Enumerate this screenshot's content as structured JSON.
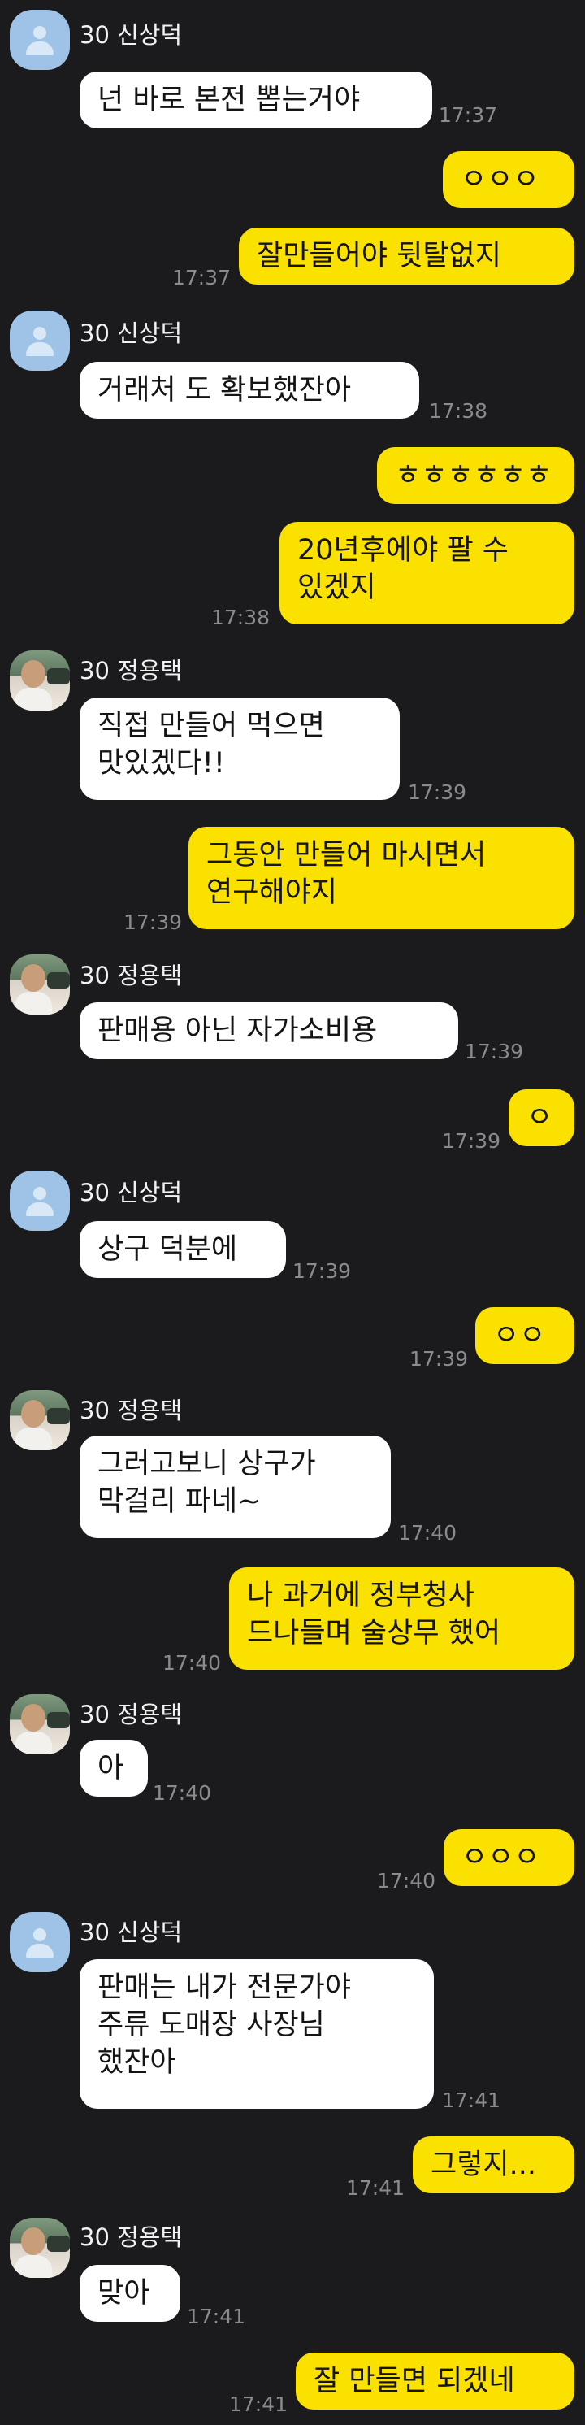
{
  "messages": [
    {
      "sender": "30 신상덕",
      "text": "넌 바로 본전 뽑는거야",
      "time": "17:37"
    },
    {
      "text": "ㅇㅇㅇ"
    },
    {
      "text": "잘만들어야 뒷탈없지",
      "time": "17:37"
    },
    {
      "sender": "30 신상덕",
      "text": "거래처 도 확보했잔아",
      "time": "17:38"
    },
    {
      "text": "ㅎㅎㅎㅎㅎㅎ"
    },
    {
      "text": "20년후에야 팔 수\n있겠지",
      "time": "17:38"
    },
    {
      "sender": "30 정용택",
      "text": "직접 만들어 먹으면\n맛있겠다!!",
      "time": "17:39"
    },
    {
      "text": "그동안 만들어 마시면서\n연구해야지",
      "time": "17:39"
    },
    {
      "sender": "30 정용택",
      "text": "판매용 아닌 자가소비용",
      "time": "17:39"
    },
    {
      "text": "ㅇ",
      "time": "17:39"
    },
    {
      "sender": "30 신상덕",
      "text": "상구 덕분에",
      "time": "17:39"
    },
    {
      "text": "ㅇㅇ",
      "time": "17:39"
    },
    {
      "sender": "30 정용택",
      "text": "그러고보니 상구가\n막걸리 파네~",
      "time": "17:40"
    },
    {
      "text": "나 과거에 정부청사\n드나들며 술상무 했어",
      "time": "17:40"
    },
    {
      "sender": "30 정용택",
      "text": "아",
      "time": "17:40"
    },
    {
      "text": "ㅇㅇㅇ",
      "time": "17:40"
    },
    {
      "sender": "30 신상덕",
      "text": "판매는 내가 전문가야\n주류 도매장 사장님\n했잔아",
      "time": "17:41"
    },
    {
      "text": "그렇지...",
      "time": "17:41"
    },
    {
      "sender": "30 정용택",
      "text": "맞아",
      "time": "17:41"
    },
    {
      "text": "잘 만들면 되겠네",
      "time": "17:41"
    }
  ]
}
